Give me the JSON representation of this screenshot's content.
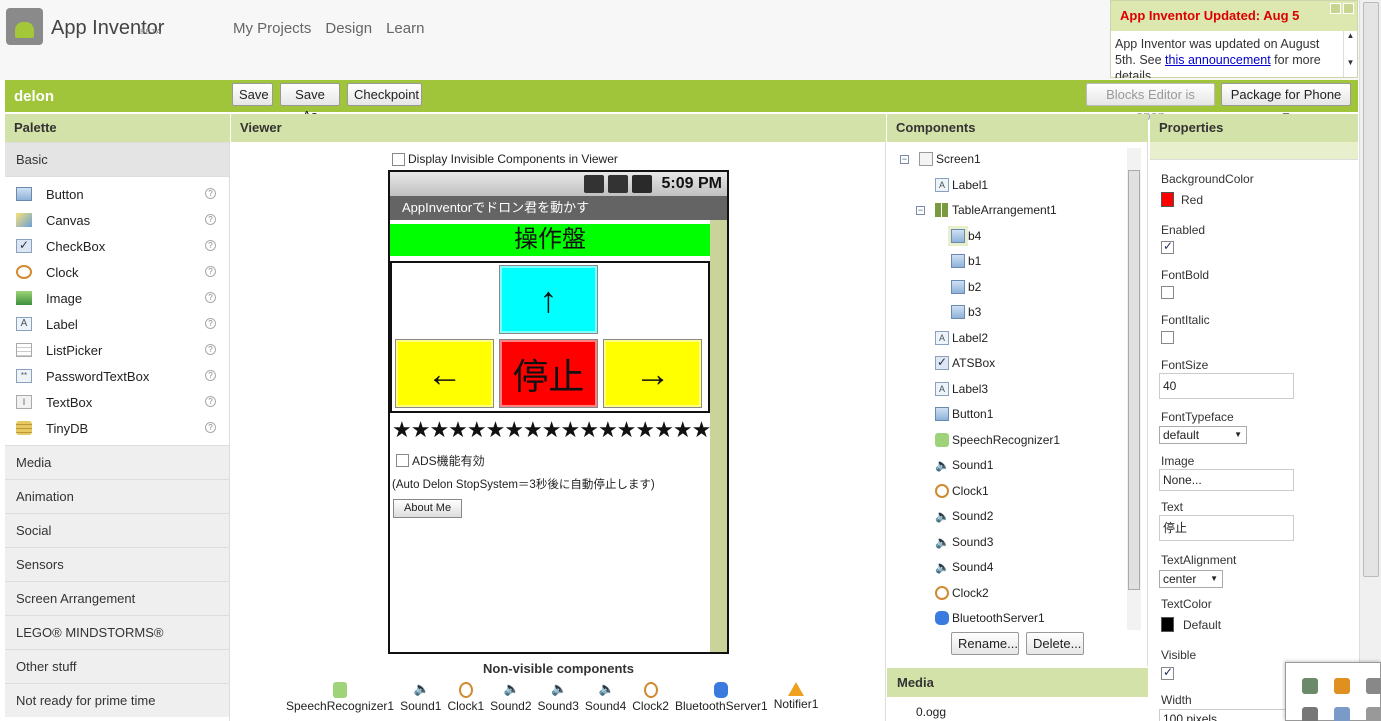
{
  "header": {
    "app_name": "App Inventor",
    "beta": "BETA",
    "nav": [
      "My Projects",
      "Design",
      "Learn"
    ]
  },
  "notice": {
    "title": "App Inventor Updated: Aug 5",
    "body_pre": "App Inventor was updated on August 5th. See ",
    "link": "this announcement",
    "body_post": " for more details"
  },
  "toolbar": {
    "project_name": "delon",
    "save": "Save",
    "save_as": "Save As",
    "checkpoint": "Checkpoint",
    "blocks_editor": "Blocks Editor is open",
    "package": "Package for Phone ▾"
  },
  "columns": {
    "palette": "Palette",
    "viewer": "Viewer",
    "components": "Components",
    "properties": "Properties"
  },
  "palette": {
    "basic": "Basic",
    "items": [
      "Button",
      "Canvas",
      "CheckBox",
      "Clock",
      "Image",
      "Label",
      "ListPicker",
      "PasswordTextBox",
      "TextBox",
      "TinyDB"
    ],
    "sections": [
      "Media",
      "Animation",
      "Social",
      "Sensors",
      "Screen Arrangement",
      "LEGO® MINDSTORMS®",
      "Other stuff",
      "Not ready for prime time"
    ]
  },
  "viewer": {
    "display_invisible": "Display Invisible Components in Viewer",
    "time": "5:09 PM",
    "screen_title": "AppInventorでドロン君を動かす",
    "label1": "操作盤",
    "up": "↑",
    "left": "←",
    "stop": "停止",
    "right": "→",
    "stars": "★★★★★★★★★★★★★★★★★★★★",
    "ads": "ADS機能有効",
    "note": "(Auto Delon StopSystem＝3秒後に自動停止します)",
    "about": "About Me",
    "nonvisible_title": "Non-visible components",
    "nonvisible": [
      "SpeechRecognizer1",
      "Sound1",
      "Clock1",
      "Sound2",
      "Sound3",
      "Sound4",
      "Clock2",
      "BluetoothServer1",
      "Notifier1"
    ]
  },
  "components": {
    "tree": [
      "Screen1",
      "Label1",
      "TableArrangement1",
      "b4",
      "b1",
      "b2",
      "b3",
      "Label2",
      "ATSBox",
      "Label3",
      "Button1",
      "SpeechRecognizer1",
      "Sound1",
      "Clock1",
      "Sound2",
      "Sound3",
      "Sound4",
      "Clock2",
      "BluetoothServer1"
    ],
    "rename": "Rename...",
    "delete": "Delete...",
    "media": "Media",
    "media_item": "0.ogg"
  },
  "properties": {
    "background_color_label": "BackgroundColor",
    "background_color_value": "Red",
    "enabled_label": "Enabled",
    "fontbold_label": "FontBold",
    "fontitalic_label": "FontItalic",
    "fontsize_label": "FontSize",
    "fontsize_value": "40",
    "fonttypeface_label": "FontTypeface",
    "fonttypeface_value": "default",
    "image_label": "Image",
    "image_value": "None...",
    "text_label": "Text",
    "text_value": "停止",
    "textalign_label": "TextAlignment",
    "textalign_value": "center",
    "textcolor_label": "TextColor",
    "textcolor_value": "Default",
    "visible_label": "Visible",
    "width_label": "Width",
    "width_value": "100 pixels"
  },
  "colors": {
    "accent": "#a0c53a",
    "header_band": "#d3e2a8",
    "red": "#ff0000",
    "cyan": "#00ffff",
    "yellow": "#ffff00",
    "green": "#00ff00"
  }
}
